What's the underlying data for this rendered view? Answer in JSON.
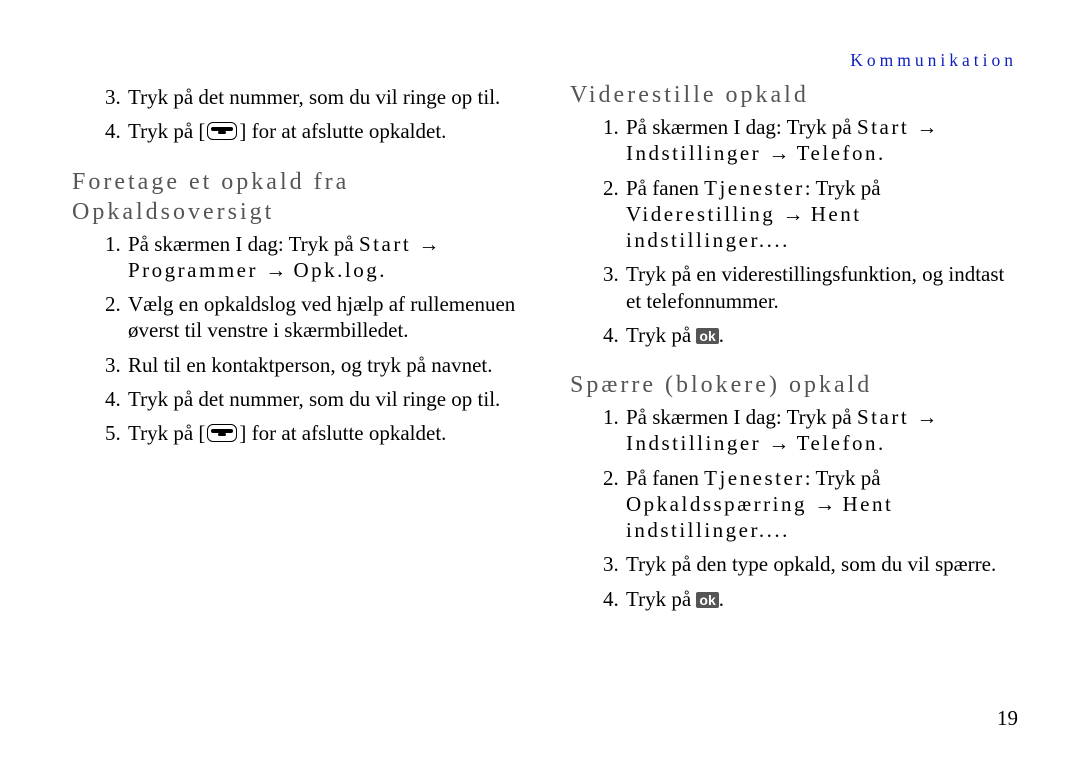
{
  "section_label": "Kommunikation",
  "page_number": "19",
  "arrows": {
    "right": "→"
  },
  "left": {
    "cont_items": [
      {
        "n": "3.",
        "text": "Tryk på det nummer, som du vil ringe op til."
      },
      {
        "n": "4.",
        "pre": "Tryk på [",
        "post": "] for at afslutte opkaldet.",
        "icon": "handset"
      }
    ],
    "h1_l1": "Foretage et opkald fra",
    "h1_l2": "Opkaldsoversigt",
    "steps": {
      "s1_a": "På skærmen I dag: Tryk på ",
      "s1_b": "Start",
      "s1_c": "Programmer",
      "s1_d": "Opk.log",
      "s2": "Vælg en opkaldslog ved hjælp af rullemenuen øverst til venstre i skærmbilledet.",
      "s3": "Rul til en kontaktperson, og tryk på navnet.",
      "s4": "Tryk på det nummer, som du vil ringe op til.",
      "s5_pre": "Tryk på [",
      "s5_post": "] for at afslutte opkaldet."
    }
  },
  "right": {
    "h1": "Viderestille opkald",
    "v": {
      "s1_a": "På skærmen I dag: Tryk på ",
      "s1_b": "Start",
      "s1_c": "Indstillinger",
      "s1_d": "Telefon",
      "s2_a": "På fanen ",
      "s2_b": "Tjenester",
      "s2_c": ": Tryk på",
      "s2_d": "Viderestilling",
      "s2_e": "Hent indstillinger...",
      "s3": "Tryk på en viderestillingsfunktion, og indtast et telefonnummer.",
      "s4_pre": "Tryk på "
    },
    "h2": "Spærre (blokere) opkald",
    "b": {
      "s1_a": "På skærmen I dag: Tryk på ",
      "s1_b": "Start",
      "s1_c": "Indstillinger",
      "s1_d": "Telefon",
      "s2_a": "På fanen ",
      "s2_b": "Tjenester",
      "s2_c": ": Tryk på",
      "s2_d": "Opkaldsspærring",
      "s2_e": "Hent indstillinger...",
      "s3": "Tryk på den type opkald, som du vil spærre.",
      "s4_pre": "Tryk på "
    }
  },
  "ok_label": "ok",
  "period": "."
}
